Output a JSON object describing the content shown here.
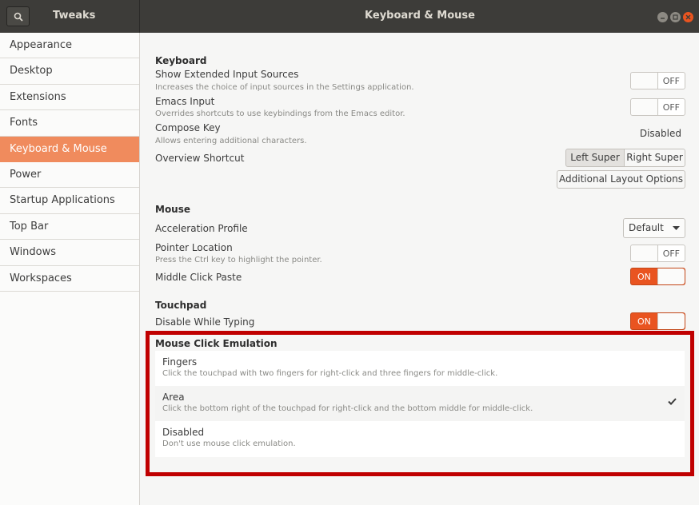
{
  "titlebar": {
    "app_title": "Tweaks",
    "title": "Keyboard & Mouse"
  },
  "sidebar": {
    "items": [
      {
        "label": "Appearance"
      },
      {
        "label": "Desktop"
      },
      {
        "label": "Extensions"
      },
      {
        "label": "Fonts"
      },
      {
        "label": "Keyboard & Mouse",
        "active": true
      },
      {
        "label": "Power"
      },
      {
        "label": "Startup Applications"
      },
      {
        "label": "Top Bar"
      },
      {
        "label": "Windows"
      },
      {
        "label": "Workspaces"
      }
    ]
  },
  "keyboard": {
    "section": "Keyboard",
    "extended": {
      "label": "Show Extended Input Sources",
      "desc": "Increases the choice of input sources in the Settings application.",
      "state": "OFF"
    },
    "emacs": {
      "label": "Emacs Input",
      "desc": "Overrides shortcuts to use keybindings from the Emacs editor.",
      "state": "OFF"
    },
    "compose": {
      "label": "Compose Key",
      "desc": "Allows entering additional characters.",
      "value": "Disabled"
    },
    "overview": {
      "label": "Overview Shortcut",
      "left": "Left Super",
      "right": "Right Super"
    },
    "layout_button": "Additional Layout Options"
  },
  "mouse": {
    "section": "Mouse",
    "accel": {
      "label": "Acceleration Profile",
      "value": "Default"
    },
    "pointer": {
      "label": "Pointer Location",
      "desc": "Press the Ctrl key to highlight the pointer.",
      "state": "OFF"
    },
    "middle": {
      "label": "Middle Click Paste",
      "state": "ON"
    }
  },
  "touchpad": {
    "section": "Touchpad",
    "typing": {
      "label": "Disable While Typing",
      "state": "ON"
    }
  },
  "emulation": {
    "section": "Mouse Click Emulation",
    "options": [
      {
        "title": "Fingers",
        "desc": "Click the touchpad with two fingers for right-click and three fingers for middle-click.",
        "selected": false
      },
      {
        "title": "Area",
        "desc": "Click the bottom right of the touchpad for right-click and the bottom middle for middle-click.",
        "selected": true
      },
      {
        "title": "Disabled",
        "desc": "Don't use mouse click emulation.",
        "selected": false
      }
    ]
  },
  "colors": {
    "accent": "#e95420",
    "sidebar_active": "#f08b5d",
    "titlebar": "#3d3c39",
    "highlight_frame": "#c00000"
  },
  "icons": [
    "search-icon",
    "minimize-icon",
    "maximize-icon",
    "close-icon",
    "chevron-down-icon",
    "checkmark-icon"
  ]
}
